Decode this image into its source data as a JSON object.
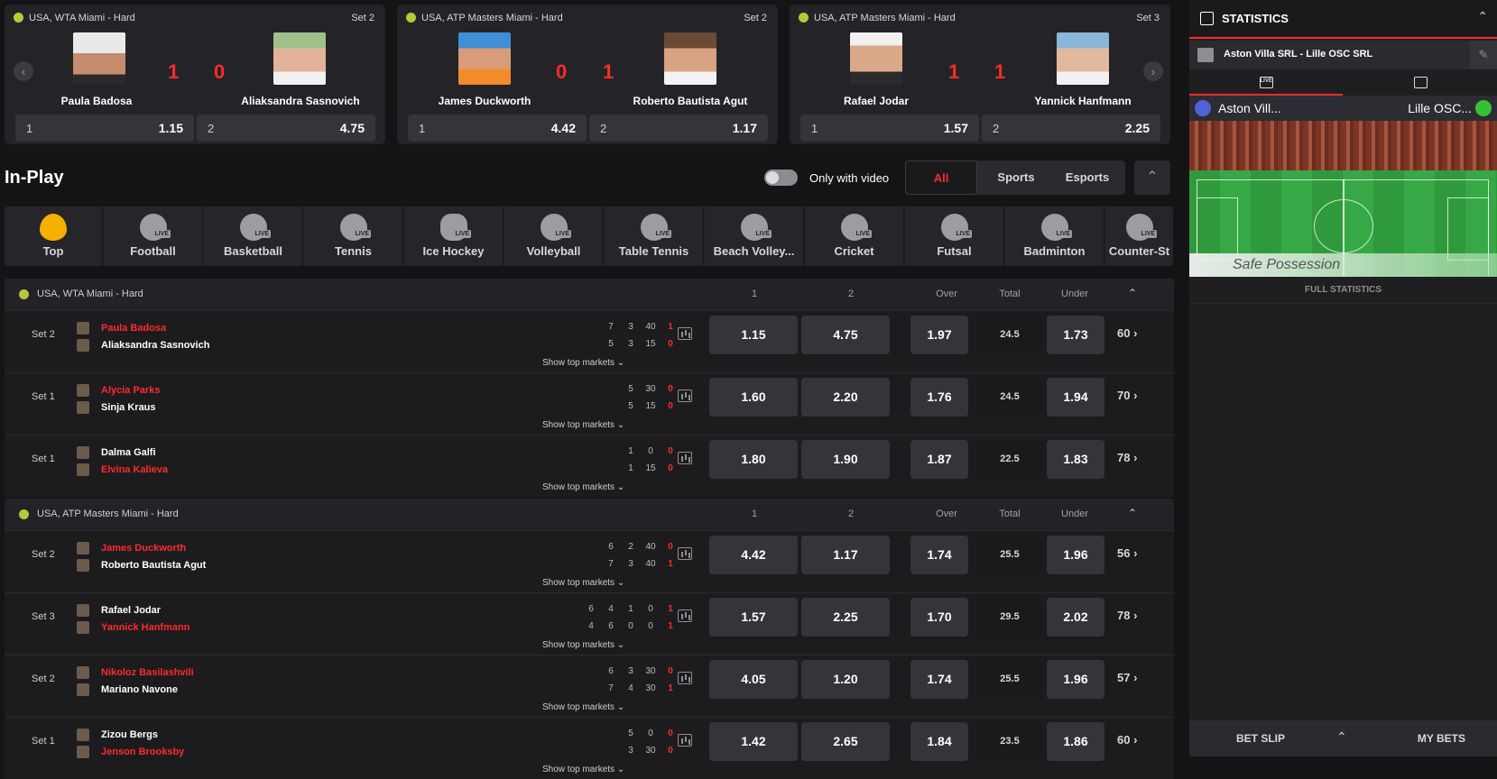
{
  "cards": [
    {
      "tournament": "USA, WTA Miami - Hard",
      "set": "Set 2",
      "p1": "Paula Badosa",
      "p2": "Aliaksandra Sasnovich",
      "s1": "1",
      "s2": "0",
      "o1k": "1",
      "o1v": "1.15",
      "o2k": "2",
      "o2v": "4.75"
    },
    {
      "tournament": "USA, ATP Masters Miami - Hard",
      "set": "Set 2",
      "p1": "James Duckworth",
      "p2": "Roberto Bautista Agut",
      "s1": "0",
      "s2": "1",
      "o1k": "1",
      "o1v": "4.42",
      "o2k": "2",
      "o2v": "1.17"
    },
    {
      "tournament": "USA, ATP Masters Miami - Hard",
      "set": "Set 3",
      "p1": "Rafael Jodar",
      "p2": "Yannick Hanfmann",
      "s1": "1",
      "s2": "1",
      "o1k": "1",
      "o1v": "1.57",
      "o2k": "2",
      "o2v": "2.25"
    }
  ],
  "inplay": {
    "title": "In-Play",
    "toggle_label": "Only with video",
    "filters": [
      "All",
      "Sports",
      "Esports"
    ]
  },
  "sports": [
    "Top",
    "Football",
    "Basketball",
    "Tennis",
    "Ice Hockey",
    "Volleyball",
    "Table Tennis",
    "Beach Volley...",
    "Cricket",
    "Futsal",
    "Badminton",
    "Counter-St"
  ],
  "live_badge": "LIVE",
  "headers": {
    "c1": "1",
    "c2": "2",
    "over": "Over",
    "total": "Total",
    "under": "Under"
  },
  "show_top": "Show top markets",
  "sections": [
    {
      "title": "USA, WTA Miami - Hard",
      "rows": [
        {
          "set": "Set 2",
          "p1": "Paula Badosa",
          "p2": "Aliaksandra Sasnovich",
          "serve": 1,
          "sc1": [
            "7",
            "3",
            "40",
            "1"
          ],
          "sc2": [
            "5",
            "3",
            "15",
            "0"
          ],
          "o1": "1.15",
          "o2": "4.75",
          "over": "1.97",
          "total": "24.5",
          "under": "1.73",
          "more": "60"
        },
        {
          "set": "Set 1",
          "p1": "Alycia Parks",
          "p2": "Sinja Kraus",
          "serve": 1,
          "sc1": [
            "5",
            "30",
            "0"
          ],
          "sc2": [
            "5",
            "15",
            "0"
          ],
          "o1": "1.60",
          "o2": "2.20",
          "over": "1.76",
          "total": "24.5",
          "under": "1.94",
          "more": "70"
        },
        {
          "set": "Set 1",
          "p1": "Dalma Galfi",
          "p2": "Elvina Kalieva",
          "serve": 2,
          "sc1": [
            "1",
            "0",
            "0"
          ],
          "sc2": [
            "1",
            "15",
            "0"
          ],
          "o1": "1.80",
          "o2": "1.90",
          "over": "1.87",
          "total": "22.5",
          "under": "1.83",
          "more": "78"
        }
      ]
    },
    {
      "title": "USA, ATP Masters Miami - Hard",
      "rows": [
        {
          "set": "Set 2",
          "p1": "James Duckworth",
          "p2": "Roberto Bautista Agut",
          "serve": 1,
          "sc1": [
            "6",
            "2",
            "40",
            "0"
          ],
          "sc2": [
            "7",
            "3",
            "40",
            "1"
          ],
          "o1": "4.42",
          "o2": "1.17",
          "over": "1.74",
          "total": "25.5",
          "under": "1.96",
          "more": "56"
        },
        {
          "set": "Set 3",
          "p1": "Rafael Jodar",
          "p2": "Yannick Hanfmann",
          "serve": 2,
          "sc1": [
            "6",
            "4",
            "1",
            "0",
            "1"
          ],
          "sc2": [
            "4",
            "6",
            "0",
            "0",
            "1"
          ],
          "o1": "1.57",
          "o2": "2.25",
          "over": "1.70",
          "total": "29.5",
          "under": "2.02",
          "more": "78"
        },
        {
          "set": "Set 2",
          "p1": "Nikoloz Basilashvili",
          "p2": "Mariano Navone",
          "serve": 1,
          "sc1": [
            "6",
            "3",
            "30",
            "0"
          ],
          "sc2": [
            "7",
            "4",
            "30",
            "1"
          ],
          "o1": "4.05",
          "o2": "1.20",
          "over": "1.74",
          "total": "25.5",
          "under": "1.96",
          "more": "57"
        },
        {
          "set": "Set 1",
          "p1": "Zizou Bergs",
          "p2": "Jenson Brooksby",
          "serve": 2,
          "sc1": [
            "5",
            "0",
            "0"
          ],
          "sc2": [
            "3",
            "30",
            "0"
          ],
          "o1": "1.42",
          "o2": "2.65",
          "over": "1.84",
          "total": "23.5",
          "under": "1.86",
          "more": "60"
        }
      ]
    }
  ],
  "stats": {
    "title": "STATISTICS",
    "match": "Aston Villa SRL - Lille OSC SRL",
    "home": "Aston Vill...",
    "away": "Lille OSC...",
    "possession": "Safe Possession",
    "full": "FULL STATISTICS",
    "live_tab": "LIVE"
  },
  "betbar": {
    "slip": "BET SLIP",
    "mybets": "MY BETS"
  },
  "colors": {
    "accent": "#ff2a2a",
    "panel": "#242428",
    "odds": "#34343a"
  }
}
